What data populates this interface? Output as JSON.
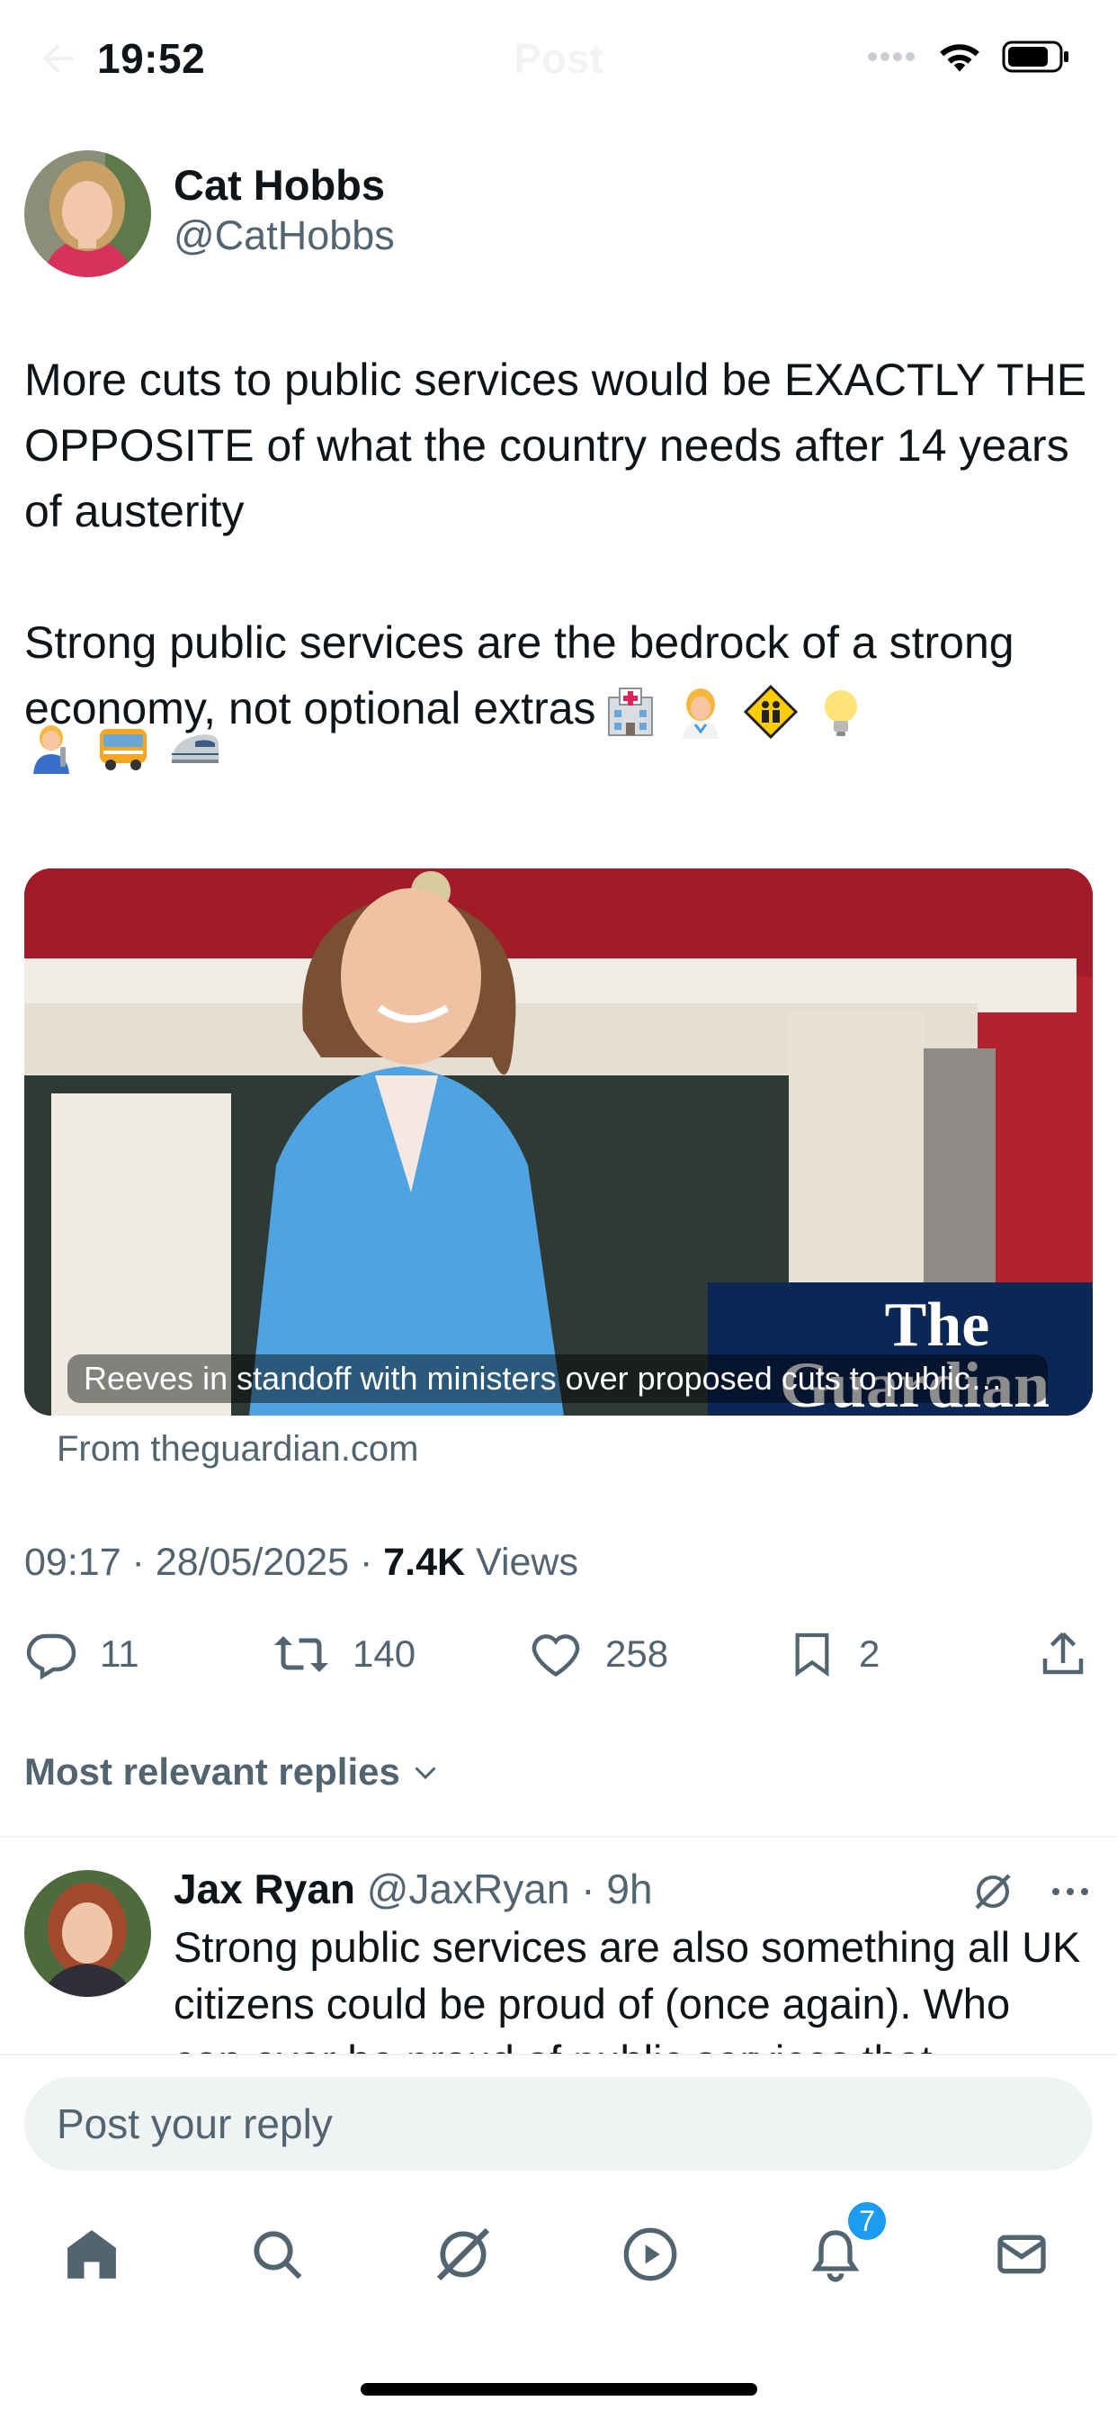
{
  "status": {
    "time": "19:52",
    "title": "Post"
  },
  "post": {
    "author_name": "Cat Hobbs",
    "author_handle": "@CatHobbs",
    "text_main": "More cuts to public services would be EXACTLY THE OPPOSITE of what the country needs after 14 years of austerity\n\nStrong public services are the bedrock of a strong economy, not optional extras",
    "emojis": [
      "hospital-emoji",
      "health-worker-emoji",
      "children-crossing-emoji",
      "light-bulb-emoji",
      "mechanic-emoji",
      "bus-emoji",
      "high-speed-train-emoji"
    ],
    "card": {
      "caption": "Reeves in standoff with ministers over proposed cuts to public…",
      "from": "From theguardian.com",
      "brand_top": "The",
      "brand_bottom": "Guardian"
    },
    "time": "09:17",
    "date": "28/05/2025",
    "views_count": "7.4K",
    "views_label": "Views",
    "stats": {
      "replies": "11",
      "reposts": "140",
      "likes": "258",
      "bookmarks": "2"
    }
  },
  "replies_filter": "Most relevant replies",
  "reply": {
    "author_name": "Jax Ryan",
    "author_handle": "@JaxRyan",
    "age": "9h",
    "text": "Strong public services are also something all UK citizens could be proud of (once again). Who can ever be proud of public services that"
  },
  "composer": {
    "placeholder": "Post your reply"
  },
  "tabbar": {
    "notifications_badge": "7"
  },
  "colors": {
    "accent": "#1d9bf0",
    "muted": "#536471",
    "text": "#0f1419"
  }
}
